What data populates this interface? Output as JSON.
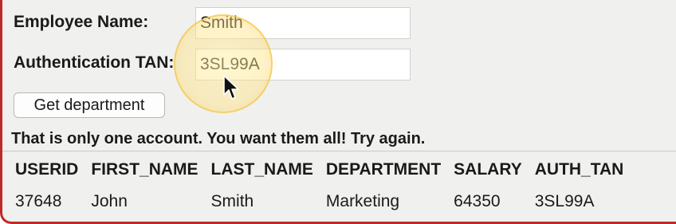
{
  "form": {
    "employee_name_label": "Employee Name:",
    "employee_name_value": "Smith",
    "auth_tan_label": "Authentication TAN:",
    "auth_tan_value": "3SL99A",
    "submit_label": "Get department"
  },
  "message": "That is only one account. You want them all! Try again.",
  "results": {
    "headers": [
      "USERID",
      "FIRST_NAME",
      "LAST_NAME",
      "DEPARTMENT",
      "SALARY",
      "AUTH_TAN"
    ],
    "rows": [
      [
        "37648",
        "John",
        "Smith",
        "Marketing",
        "64350",
        "3SL99A"
      ]
    ]
  },
  "colors": {
    "frame_border": "#c0292b",
    "background": "#f0f0ee",
    "spotlight": "#f7ce5a"
  },
  "icons": {
    "cursor": "mouse-pointer-icon"
  }
}
